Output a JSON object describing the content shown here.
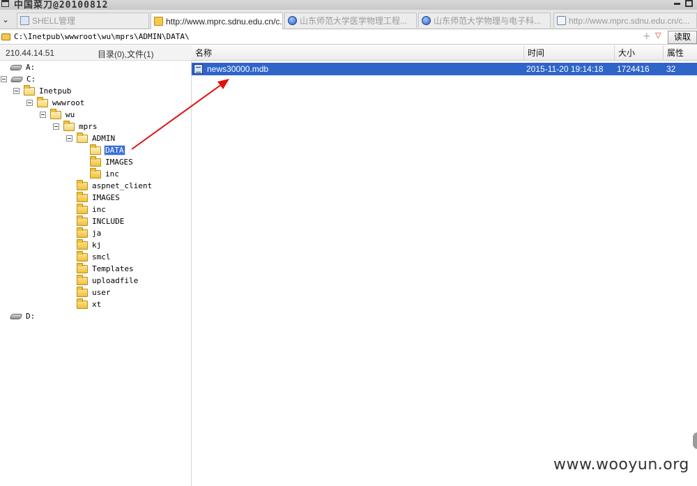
{
  "window": {
    "title": "中国菜刀@20100812"
  },
  "tabs": [
    {
      "label": "SHELL管理",
      "icon": "shell-icon",
      "active": false
    },
    {
      "label": "http://www.mprc.sdnu.edu.cn/c...",
      "icon": "folder-icon",
      "active": true
    },
    {
      "label": "山东师范大学医学物理工程...",
      "icon": "globe-icon",
      "active": false
    },
    {
      "label": "山东师范大学物理与电子科...",
      "icon": "globe-icon",
      "active": false
    },
    {
      "label": "http://www.mprc.sdnu.edu.cn/c...",
      "icon": "page-icon",
      "active": false
    }
  ],
  "address": {
    "path": "C:\\Inetpub\\wwwroot\\wu\\mprs\\ADMIN\\DATA\\",
    "read_label": "读取"
  },
  "info": {
    "ip": "210.44.14.51",
    "counts": "目录(0),文件(1)"
  },
  "columns": {
    "name": "名称",
    "time": "时间",
    "size": "大小",
    "attr": "属性"
  },
  "tree": {
    "drive_a": "A:",
    "drive_c": "C:",
    "inetpub": "Inetpub",
    "wwwroot": "wwwroot",
    "wu": "wu",
    "mprs": "mprs",
    "admin": "ADMIN",
    "data": "DATA",
    "images_sub": "IMAGES",
    "inc_sub": "inc",
    "wu_children": [
      "aspnet_client",
      "IMAGES",
      "inc",
      "INCLUDE",
      "ja",
      "kj",
      "smcl",
      "Templates",
      "uploadfile",
      "user",
      "xt"
    ],
    "drive_d": "D:"
  },
  "files": [
    {
      "name": "news30000.mdb",
      "time": "2015-11-20 19:14:18",
      "size": "1724416",
      "attr": "32"
    }
  ],
  "annotation": {
    "arrow_color": "#e01010"
  },
  "watermark": "www.wooyun.org"
}
